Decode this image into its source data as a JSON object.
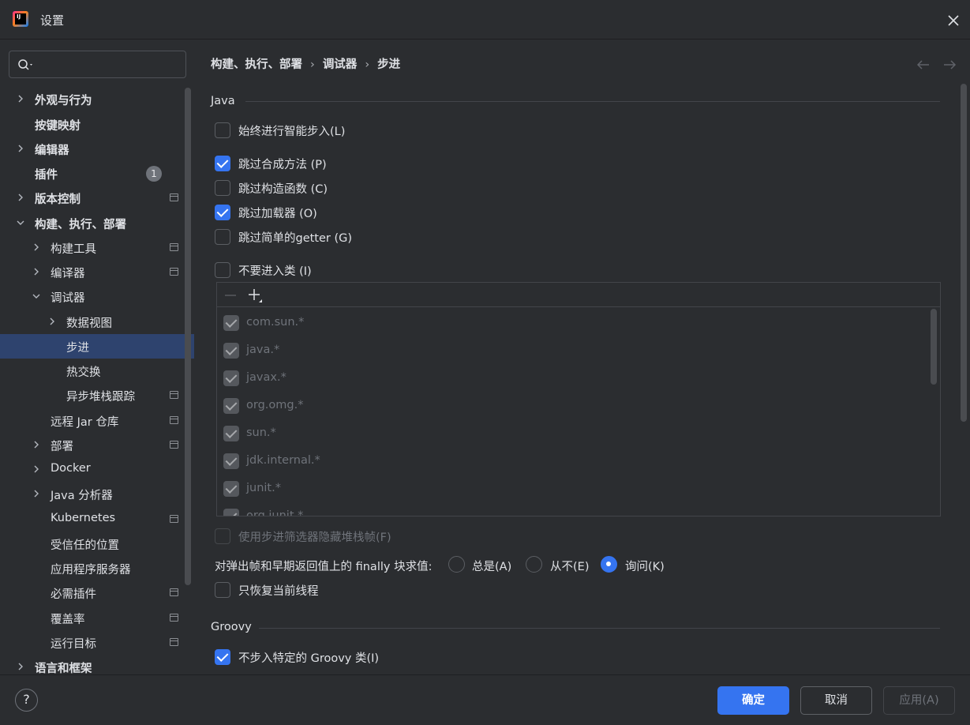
{
  "window": {
    "title": "设置",
    "logo_text": "IJ"
  },
  "sidebar": {
    "search_placeholder": "",
    "items": [
      {
        "label": "外观与行为",
        "expanded": false
      },
      {
        "label": "按键映射"
      },
      {
        "label": "编辑器",
        "expanded": false
      },
      {
        "label": "插件",
        "badge": "1"
      },
      {
        "label": "版本控制",
        "expanded": false
      },
      {
        "label": "构建、执行、部署",
        "expanded": true
      },
      {
        "label": "构建工具",
        "expanded": false
      },
      {
        "label": "编译器",
        "expanded": false
      },
      {
        "label": "调试器",
        "expanded": true
      },
      {
        "label": "数据视图",
        "expanded": false
      },
      {
        "label": "步进",
        "selected": true
      },
      {
        "label": "热交换"
      },
      {
        "label": "异步堆栈跟踪"
      },
      {
        "label": "远程 Jar 仓库"
      },
      {
        "label": "部署",
        "expanded": false
      },
      {
        "label": "Docker",
        "expanded": false
      },
      {
        "label": "Java 分析器",
        "expanded": false
      },
      {
        "label": "Kubernetes"
      },
      {
        "label": "受信任的位置"
      },
      {
        "label": "应用程序服务器"
      },
      {
        "label": "必需插件"
      },
      {
        "label": "覆盖率"
      },
      {
        "label": "运行目标"
      },
      {
        "label": "语言和框架",
        "expanded": false
      }
    ]
  },
  "breadcrumb": [
    "构建、执行、部署",
    "调试器",
    "步进"
  ],
  "breadcrumb_sep": "›",
  "java": {
    "title": "Java",
    "always_smart_step": {
      "label": "始终进行智能步入(L)",
      "checked": false
    },
    "skip_synthetic": {
      "label": "跳过合成方法 (P)",
      "checked": true
    },
    "skip_constructors": {
      "label": "跳过构造函数 (C)",
      "checked": false
    },
    "skip_classloaders": {
      "label": "跳过加载器 (O)",
      "checked": true
    },
    "skip_simple_getters": {
      "label": "跳过简单的getter (G)",
      "checked": false
    },
    "do_not_step_into": {
      "label": "不要进入类 (I)",
      "checked": false
    },
    "classes": [
      "com.sun.*",
      "java.*",
      "javax.*",
      "org.omg.*",
      "sun.*",
      "jdk.internal.*",
      "junit.*",
      "org.junit.*"
    ],
    "hide_stack_frames": {
      "label": "使用步进筛选器隐藏堆栈帧(F)",
      "checked": false,
      "disabled": true
    },
    "finally_question": "对弹出帧和早期返回值上的 finally 块求值:",
    "finally_options": [
      {
        "label": "总是(A)",
        "selected": false
      },
      {
        "label": "从不(E)",
        "selected": false
      },
      {
        "label": "询问(K)",
        "selected": true
      }
    ],
    "resume_current_thread": {
      "label": "只恢复当前线程",
      "checked": false
    }
  },
  "groovy": {
    "title": "Groovy",
    "do_not_step_groovy": {
      "label": "不步入特定的 Groovy 类(I)",
      "checked": true
    }
  },
  "footer": {
    "help": "?",
    "ok": "确定",
    "cancel": "取消",
    "apply": "应用(A)"
  },
  "colors": {
    "accent": "#3574f0",
    "background": "#2b2d30",
    "selection": "#2e436e"
  }
}
